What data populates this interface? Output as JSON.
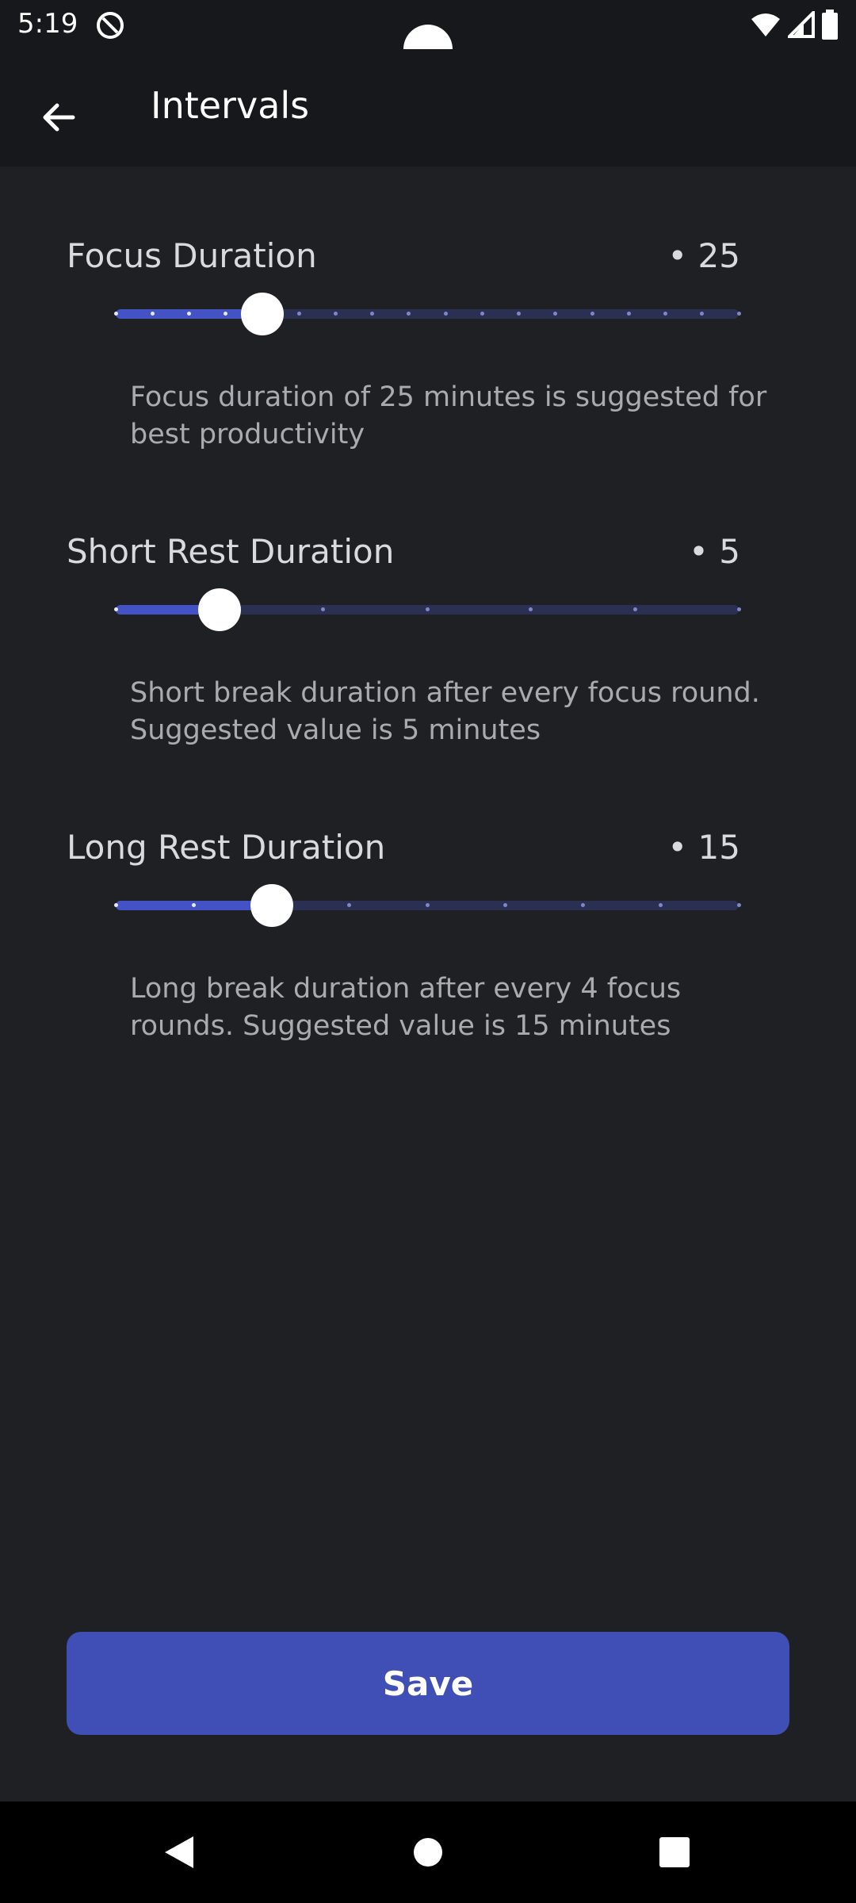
{
  "status_bar": {
    "time": "5:19",
    "icons": [
      "do-not-disturb-icon",
      "wifi-icon",
      "signal-icon",
      "battery-icon"
    ]
  },
  "app_bar": {
    "title": "Intervals",
    "back_icon": "arrow-back-icon"
  },
  "settings": [
    {
      "label": "Focus Duration",
      "value_text": "• 25",
      "value": 25,
      "ticks": 18,
      "thumb_fraction": 0.2353,
      "description": "Focus duration of 25 minutes is suggested for best productivity"
    },
    {
      "label": "Short Rest Duration",
      "value_text": "• 5",
      "value": 5,
      "ticks": 7,
      "thumb_fraction": 0.1667,
      "description": "Short break duration after every focus round. Suggested value is 5 minutes"
    },
    {
      "label": "Long Rest Duration",
      "value_text": "• 15",
      "value": 15,
      "ticks": 9,
      "thumb_fraction": 0.25,
      "description": "Long break duration after every 4 focus rounds. Suggested value is 15 minutes"
    }
  ],
  "save_button": {
    "label": "Save"
  },
  "nav_bar": {
    "icons": [
      "nav-back-icon",
      "nav-home-icon",
      "nav-recents-icon"
    ]
  },
  "colors": {
    "background": "#1e2024",
    "app_bar": "#17181b",
    "accent": "#3f4fb5",
    "slider_inactive": "#2b3052"
  }
}
